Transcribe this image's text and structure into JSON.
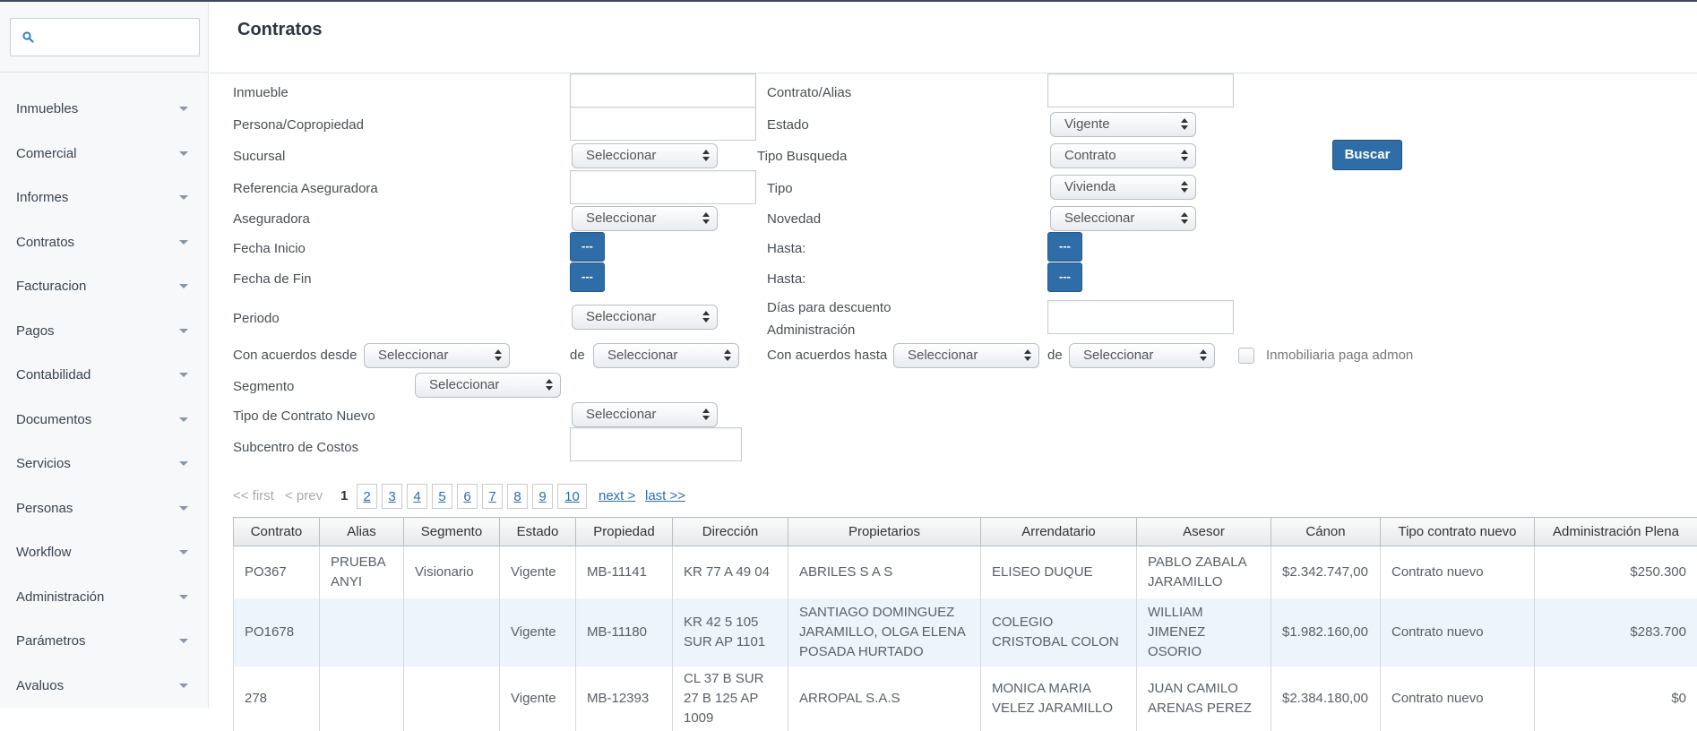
{
  "sidebar": {
    "search_placeholder": "",
    "items": [
      {
        "label": "Inmuebles"
      },
      {
        "label": "Comercial"
      },
      {
        "label": "Informes"
      },
      {
        "label": "Contratos"
      },
      {
        "label": "Facturacion"
      },
      {
        "label": "Pagos"
      },
      {
        "label": "Contabilidad"
      },
      {
        "label": "Documentos"
      },
      {
        "label": "Servicios"
      },
      {
        "label": "Personas"
      },
      {
        "label": "Workflow"
      },
      {
        "label": "Administración"
      },
      {
        "label": "Parámetros"
      },
      {
        "label": "Avaluos"
      }
    ]
  },
  "page": {
    "title": "Contratos"
  },
  "filters": {
    "inmueble": {
      "label": "Inmueble",
      "value": ""
    },
    "contrato_alias": {
      "label": "Contrato/Alias",
      "value": ""
    },
    "persona": {
      "label": "Persona/Copropiedad",
      "value": ""
    },
    "estado": {
      "label": "Estado",
      "value": "Vigente"
    },
    "sucursal": {
      "label": "Sucursal",
      "value": "Seleccionar"
    },
    "tipo_busqueda": {
      "label": "Tipo Busqueda",
      "value": "Contrato"
    },
    "buscar_label": "Buscar",
    "ref_aseguradora": {
      "label": "Referencia Aseguradora",
      "value": ""
    },
    "tipo": {
      "label": "Tipo",
      "value": "Vivienda"
    },
    "aseguradora": {
      "label": "Aseguradora",
      "value": "Seleccionar"
    },
    "novedad": {
      "label": "Novedad",
      "value": "Seleccionar"
    },
    "fecha_inicio": {
      "label": "Fecha Inicio",
      "button": "---"
    },
    "hasta_1": {
      "label": "Hasta:",
      "button": "---"
    },
    "fecha_fin": {
      "label": "Fecha de Fin",
      "button": "---"
    },
    "hasta_2": {
      "label": "Hasta:",
      "button": "---"
    },
    "periodo": {
      "label": "Periodo",
      "value": "Seleccionar"
    },
    "dias_descuento": {
      "label_line1": "Días para descuento",
      "label_line2": "Administración",
      "value": ""
    },
    "acuerdos_desde": {
      "label": "Con acuerdos desde",
      "value": "Seleccionar",
      "de_label": "de",
      "de_value": "Seleccionar"
    },
    "acuerdos_hasta": {
      "label": "Con acuerdos hasta",
      "value": "Seleccionar",
      "de_label": "de",
      "de_value": "Seleccionar"
    },
    "inmobiliaria_paga": {
      "label": "Inmobiliaria paga admon",
      "checked": false
    },
    "segmento": {
      "label": "Segmento",
      "value": "Seleccionar"
    },
    "tipo_contrato_nuevo": {
      "label": "Tipo de Contrato Nuevo",
      "value": "Seleccionar"
    },
    "subcentro": {
      "label": "Subcentro de Costos",
      "value": ""
    }
  },
  "pagination": {
    "first": "<< first",
    "prev": "< prev",
    "current": "1",
    "pages": [
      "2",
      "3",
      "4",
      "5",
      "6",
      "7",
      "8",
      "9",
      "10"
    ],
    "next": "next >",
    "last": "last >>"
  },
  "table": {
    "columns": [
      "Contrato",
      "Alias",
      "Segmento",
      "Estado",
      "Propiedad",
      "Dirección",
      "Propietarios",
      "Arrendatario",
      "Asesor",
      "Cánon",
      "Tipo contrato nuevo",
      "Administración Plena"
    ],
    "rows": [
      [
        "PO367",
        "PRUEBA ANYI",
        "Visionario",
        "Vigente",
        "MB-11141",
        "KR 77 A 49 04",
        "ABRILES S A S",
        "ELISEO DUQUE",
        "PABLO ZABALA JARAMILLO",
        "$2.342.747,00",
        "Contrato nuevo",
        "$250.300"
      ],
      [
        "PO1678",
        "",
        "",
        "Vigente",
        "MB-11180",
        "KR 42 5 105 SUR AP 1101",
        "SANTIAGO DOMINGUEZ JARAMILLO, OLGA ELENA POSADA HURTADO",
        "COLEGIO CRISTOBAL COLON",
        "WILLIAM JIMENEZ OSORIO",
        "$1.982.160,00",
        "Contrato nuevo",
        "$283.700"
      ],
      [
        "278",
        "",
        "",
        "Vigente",
        "MB-12393",
        "CL 37 B SUR 27 B 125 AP 1009",
        "ARROPAL S.A.S",
        "MONICA MARIA VELEZ JARAMILLO",
        "JUAN CAMILO ARENAS PEREZ",
        "$2.384.180,00",
        "Contrato nuevo",
        "$0"
      ]
    ]
  }
}
